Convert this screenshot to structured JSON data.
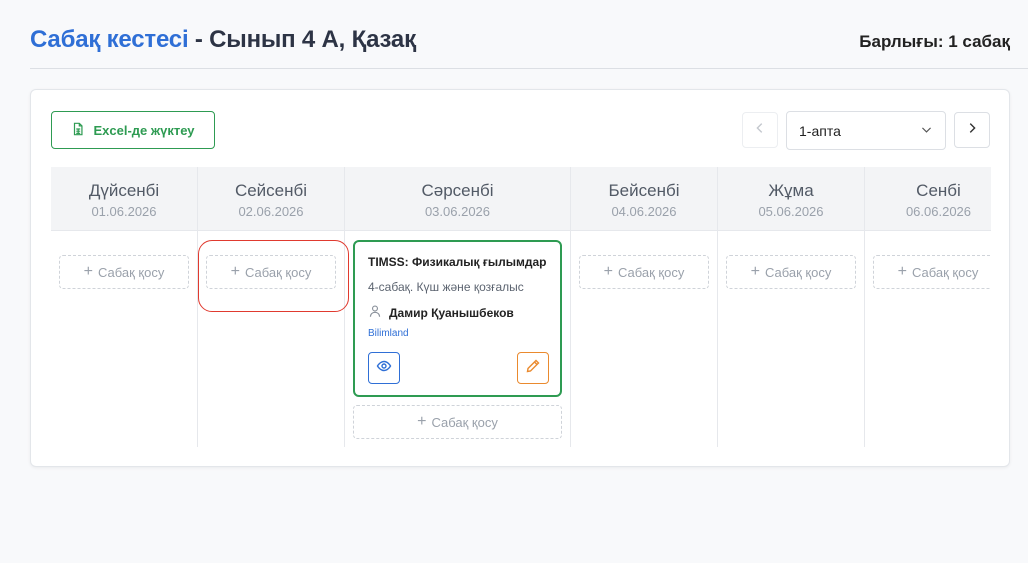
{
  "header": {
    "title_accent": "Сабақ кестесі",
    "title_rest": " - Сынып 4 А, Қазақ",
    "total": "Барлығы: 1 сабақ"
  },
  "toolbar": {
    "excel_label": "Excel-де жүктеу",
    "excel_icon": "spreadsheet-icon",
    "week_selected": "1-апта"
  },
  "days": [
    {
      "name": "Дүйсенбі",
      "date": "01.06.2026"
    },
    {
      "name": "Сейсенбі",
      "date": "02.06.2026"
    },
    {
      "name": "Сәрсенбі",
      "date": "03.06.2026"
    },
    {
      "name": "Бейсенбі",
      "date": "04.06.2026"
    },
    {
      "name": "Жұма",
      "date": "05.06.2026"
    },
    {
      "name": "Сенбі",
      "date": "06.06.2026"
    }
  ],
  "add_lesson_label": "Сабақ қосу",
  "lesson": {
    "title": "TIMSS: Физикалық ғылымдар",
    "subtitle": "4-сабақ. Күш және қозғалыс",
    "teacher": "Дамир Қуанышбеков",
    "platform": "Bilimland"
  },
  "colors": {
    "accent_blue": "#2f6fd6",
    "success_green": "#2e9b52",
    "edit_orange": "#ea8a2e",
    "highlight_red": "#e03a2f"
  }
}
